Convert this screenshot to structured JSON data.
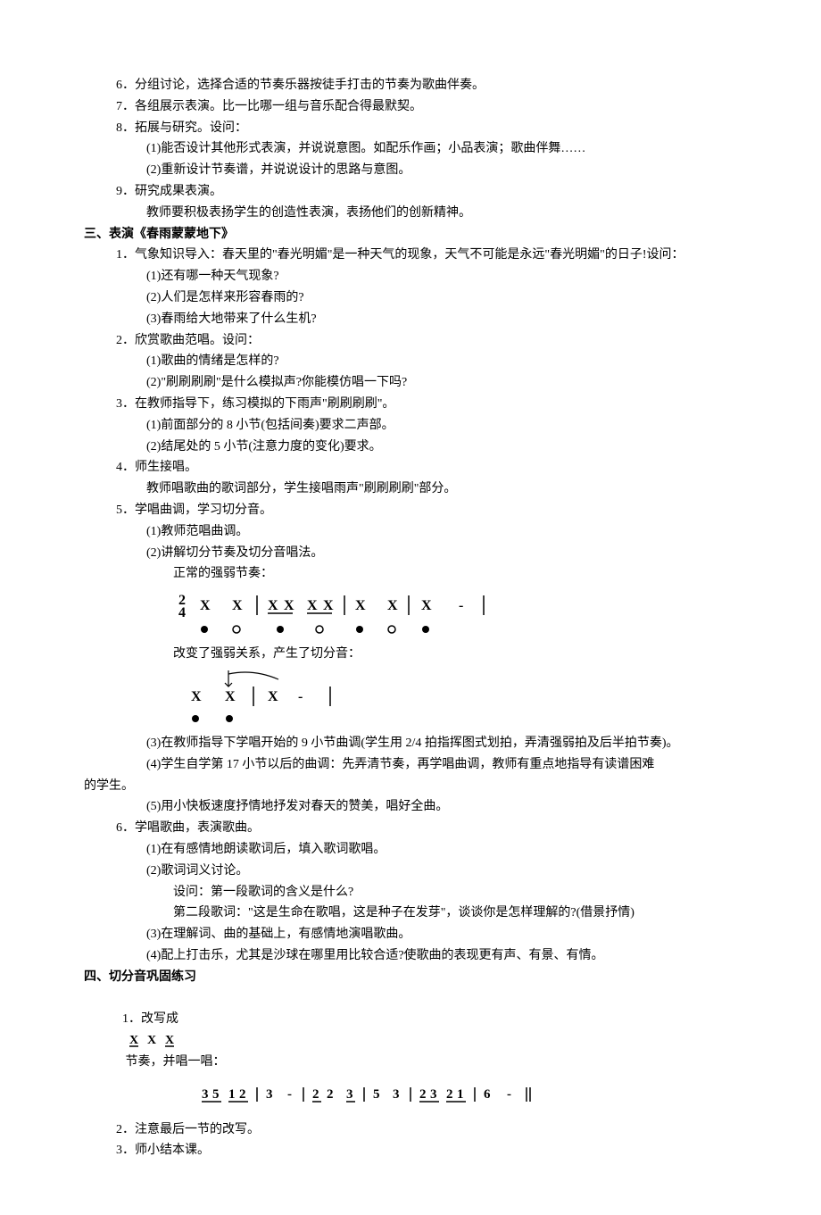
{
  "doc": {
    "l1": "6．分组讨论，选择合适的节奏乐器按徒手打击的节奏为歌曲伴奏。",
    "l2": "7．各组展示表演。比一比哪一组与音乐配合得最默契。",
    "l3": "8．拓展与研究。设问：",
    "l3a": "(1)能否设计其他形式表演，并说说意图。如配乐作画；小品表演；歌曲伴舞……",
    "l3b": "(2)重新设计节奏谱，并说说设计的思路与意图。",
    "l4": "9．研究成果表演。",
    "l4a": "教师要积极表扬学生的创造性表演，表扬他们的创新精神。",
    "h3": "三、表演《春雨蒙蒙地下》",
    "s1": "1．气象知识导入：春天里的\"春光明媚\"是一种天气的现象，天气不可能是永远\"春光明媚\"的日子!设问：",
    "s1a": "(1)还有哪一种天气现象?",
    "s1b": "(2)人们是怎样来形容春雨的?",
    "s1c": "(3)春雨给大地带来了什么生机?",
    "s2": "2．欣赏歌曲范唱。设问：",
    "s2a": "(1)歌曲的情绪是怎样的?",
    "s2b": "(2)\"刷刷刷刷\"是什么模拟声?你能模仿唱一下吗?",
    "s3": "3．在教师指导下，练习模拟的下雨声\"刷刷刷刷\"。",
    "s3a": "(1)前面部分的 8 小节(包括间奏)要求二声部。",
    "s3b": "(2)结尾处的 5 小节(注意力度的变化)要求。",
    "s4": "4．师生接唱。",
    "s4a": "教师唱歌曲的歌词部分，学生接唱雨声\"刷刷刷刷\"部分。",
    "s5": "5．学唱曲调，学习切分音。",
    "s5a": "(1)教师范唱曲调。",
    "s5b": "(2)讲解切分节奏及切分音唱法。",
    "note1": "正常的强弱节奏：",
    "note2": "改变了强弱关系，产生了切分音：",
    "s5c": "(3)在教师指导下学唱开始的 9 小节曲调(学生用 2/4 拍指挥图式划拍，弄清强弱拍及后半拍节奏)。",
    "s5d": "(4)学生自学第 17 小节以后的曲调：先弄清节奏，再学唱曲调，教师有重点地指导有读谱困难",
    "s5d2": "的学生。",
    "s5e": "(5)用小快板速度抒情地抒发对春天的赞美，唱好全曲。",
    "s6": "6．学唱歌曲，表演歌曲。",
    "s6a": "(1)在有感情地朗读歌词后，填入歌词歌唱。",
    "s6b": "(2)歌词词义讨论。",
    "s6b1": "设问：第一段歌词的含义是什么?",
    "s6b2": "第二段歌词：\"这是生命在歌唱，这是种子在发芽\"，谈谈你是怎样理解的?(借景抒情)",
    "s6c": "(3)在理解词、曲的基础上，有感情地演唱歌曲。",
    "s6d": "(4)配上打击乐，尤其是沙球在哪里用比较合适?使歌曲的表现更有声、有景、有情。",
    "h4": "四、切分音巩固练习",
    "p1a": "1．改写成 ",
    "p1b": " 节奏，并唱一唱：",
    "p2": "2．注意最后一节的改写。",
    "p3": "3．师小结本课。"
  },
  "notation": {
    "timesig": "2/4",
    "pattern_line": "X X | X X X X | X X | X - |",
    "syncopation_line": "X X | X - |",
    "melody": "3 5 1 2 | 3 - | 2 2 3 | 5 3 | 2 3 2 1 | 6 - ‖",
    "inline_rhythm": "X X X"
  }
}
